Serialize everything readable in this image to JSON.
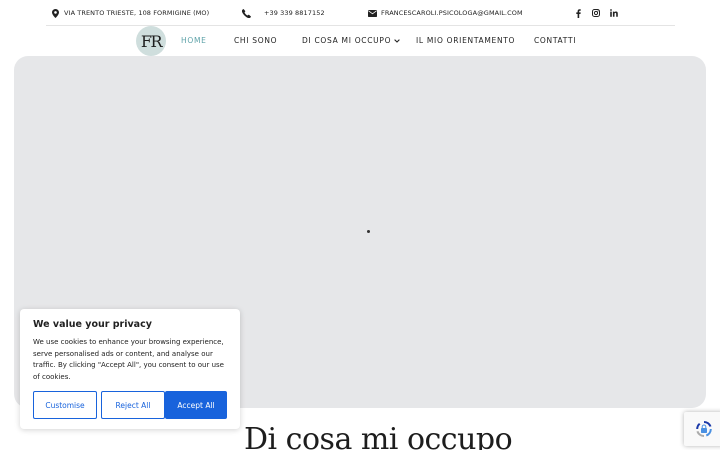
{
  "topbar": {
    "address": "VIA TRENTO TRIESTE, 108 FORMIGINE (MO)",
    "phone": "+39 339 8817152",
    "email": "FRANCESCAROLI.PSICOLOGA@GMAIL.COM",
    "social_icons": [
      "facebook-icon",
      "instagram-icon",
      "linkedin-icon"
    ]
  },
  "logo": {
    "text": "FR",
    "bg_color": "#cfdedd"
  },
  "nav": {
    "items": [
      {
        "label": "HOME",
        "active": true
      },
      {
        "label": "CHI SONO"
      },
      {
        "label": "DI COSA MI OCCUPO",
        "has_dropdown": true
      },
      {
        "label": "IL MIO ORIENTAMENTO"
      },
      {
        "label": "CONTATTI"
      }
    ],
    "active_color": "#5fa3a9"
  },
  "main": {
    "section_title": "Di cosa mi occupo"
  },
  "cookie_banner": {
    "title": "We value your privacy",
    "text": "We use cookies to enhance your browsing experience, serve personalised ads or content, and analyse our traffic. By clicking \"Accept All\", you consent to our use of cookies.",
    "customise_label": "Customise",
    "reject_label": "Reject All",
    "accept_label": "Accept All",
    "accent_color": "#1863dc"
  }
}
